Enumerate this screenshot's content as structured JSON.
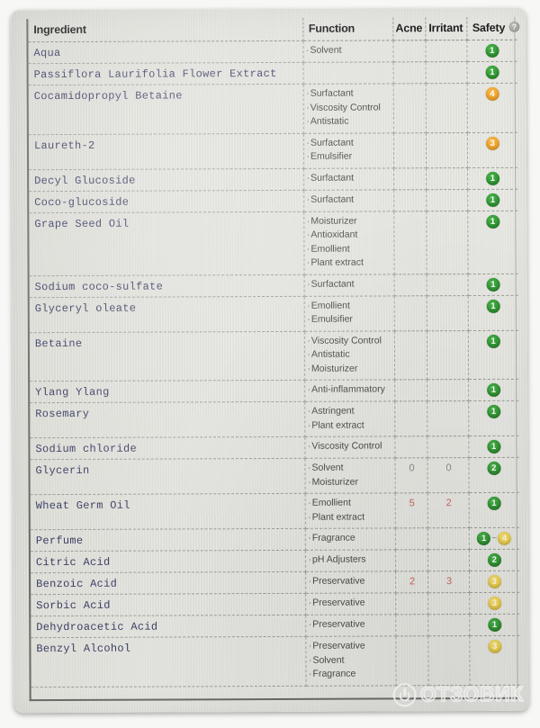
{
  "table": {
    "columns": {
      "ingredient": "Ingredient",
      "function": "Function",
      "acne": "Acne",
      "irritant": "Irritant",
      "safety": "Safety",
      "help_icon": "?"
    },
    "rows": [
      {
        "ingredient": "Aqua",
        "functions": [
          "Solvent"
        ],
        "acne": "",
        "irritant": "",
        "safety": [
          {
            "value": "1",
            "color": "green"
          }
        ]
      },
      {
        "ingredient": "Passiflora Laurifolia Flower Extract",
        "functions": [],
        "acne": "",
        "irritant": "",
        "safety": [
          {
            "value": "1",
            "color": "green"
          }
        ]
      },
      {
        "ingredient": "Cocamidopropyl Betaine",
        "functions": [
          "Surfactant",
          "Viscosity Control",
          "Antistatic"
        ],
        "acne": "",
        "irritant": "",
        "safety": [
          {
            "value": "4",
            "color": "orange"
          }
        ]
      },
      {
        "ingredient": "Laureth-2",
        "functions": [
          "Surfactant",
          "Emulsifier"
        ],
        "acne": "",
        "irritant": "",
        "safety": [
          {
            "value": "3",
            "color": "orange"
          }
        ]
      },
      {
        "ingredient": "Decyl Glucoside",
        "functions": [
          "Surfactant"
        ],
        "acne": "",
        "irritant": "",
        "safety": [
          {
            "value": "1",
            "color": "green"
          }
        ]
      },
      {
        "ingredient": "Coco-glucoside",
        "functions": [
          "Surfactant"
        ],
        "acne": "",
        "irritant": "",
        "safety": [
          {
            "value": "1",
            "color": "green"
          }
        ]
      },
      {
        "ingredient": "Grape Seed Oil",
        "functions": [
          "Moisturizer",
          "Antioxidant",
          "Emollient",
          "Plant extract"
        ],
        "acne": "",
        "irritant": "",
        "safety": [
          {
            "value": "1",
            "color": "green"
          }
        ]
      },
      {
        "ingredient": "Sodium coco-sulfate",
        "functions": [
          "Surfactant"
        ],
        "acne": "",
        "irritant": "",
        "safety": [
          {
            "value": "1",
            "color": "green"
          }
        ]
      },
      {
        "ingredient": "Glyceryl oleate",
        "functions": [
          "Emollient",
          "Emulsifier"
        ],
        "acne": "",
        "irritant": "",
        "safety": [
          {
            "value": "1",
            "color": "green"
          }
        ]
      },
      {
        "ingredient": "Betaine",
        "functions": [
          "Viscosity Control",
          "Antistatic",
          "Moisturizer"
        ],
        "acne": "",
        "irritant": "",
        "safety": [
          {
            "value": "1",
            "color": "green"
          }
        ]
      },
      {
        "ingredient": "Ylang Ylang",
        "functions": [
          "Anti-inflammatory"
        ],
        "acne": "",
        "irritant": "",
        "safety": [
          {
            "value": "1",
            "color": "green"
          }
        ]
      },
      {
        "ingredient": "Rosemary",
        "functions": [
          "Astringent",
          "Plant extract"
        ],
        "acne": "",
        "irritant": "",
        "safety": [
          {
            "value": "1",
            "color": "green"
          }
        ]
      },
      {
        "ingredient": "Sodium chloride",
        "functions": [
          "Viscosity Control"
        ],
        "acne": "",
        "irritant": "",
        "safety": [
          {
            "value": "1",
            "color": "green"
          }
        ]
      },
      {
        "ingredient": "Glycerin",
        "functions": [
          "Solvent",
          "Moisturizer"
        ],
        "acne": "0",
        "irritant": "0",
        "safety": [
          {
            "value": "2",
            "color": "green"
          }
        ]
      },
      {
        "ingredient": "Wheat Germ Oil",
        "functions": [
          "Emollient",
          "Plant extract"
        ],
        "acne": "5",
        "irritant": "2",
        "acne_warn": true,
        "irritant_warn": true,
        "safety": [
          {
            "value": "1",
            "color": "green"
          }
        ]
      },
      {
        "ingredient": "Perfume",
        "functions": [
          "Fragrance"
        ],
        "acne": "",
        "irritant": "",
        "safety": [
          {
            "value": "1",
            "color": "green"
          },
          {
            "value": "~",
            "color": "separator"
          },
          {
            "value": "4",
            "color": "yellow"
          }
        ]
      },
      {
        "ingredient": "Citric Acid",
        "functions": [
          "pH Adjusters"
        ],
        "acne": "",
        "irritant": "",
        "safety": [
          {
            "value": "2",
            "color": "green"
          }
        ]
      },
      {
        "ingredient": "Benzoic Acid",
        "functions": [
          "Preservative"
        ],
        "acne": "2",
        "irritant": "3",
        "acne_warn": true,
        "irritant_warn": true,
        "safety": [
          {
            "value": "3",
            "color": "yellow"
          }
        ]
      },
      {
        "ingredient": "Sorbic Acid",
        "functions": [
          "Preservative"
        ],
        "acne": "",
        "irritant": "",
        "safety": [
          {
            "value": "3",
            "color": "yellow"
          }
        ]
      },
      {
        "ingredient": "Dehydroacetic Acid",
        "functions": [
          "Preservative"
        ],
        "acne": "",
        "irritant": "",
        "safety": [
          {
            "value": "1",
            "color": "green"
          }
        ]
      },
      {
        "ingredient": "Benzyl Alcohol",
        "functions": [
          "Preservative",
          "Solvent",
          "Fragrance"
        ],
        "acne": "",
        "irritant": "",
        "safety": [
          {
            "value": "3",
            "color": "yellow"
          }
        ]
      }
    ]
  },
  "watermark": {
    "text": "отзовик",
    "logo": "circle-power-logo"
  },
  "colors": {
    "safety_green": "#2e9131",
    "safety_orange": "#efa22a",
    "safety_yellow": "#eed14c",
    "warn_number": "#c86a5e",
    "ingredient_text": "#3b3f63",
    "paper": "#e2e2dd"
  }
}
